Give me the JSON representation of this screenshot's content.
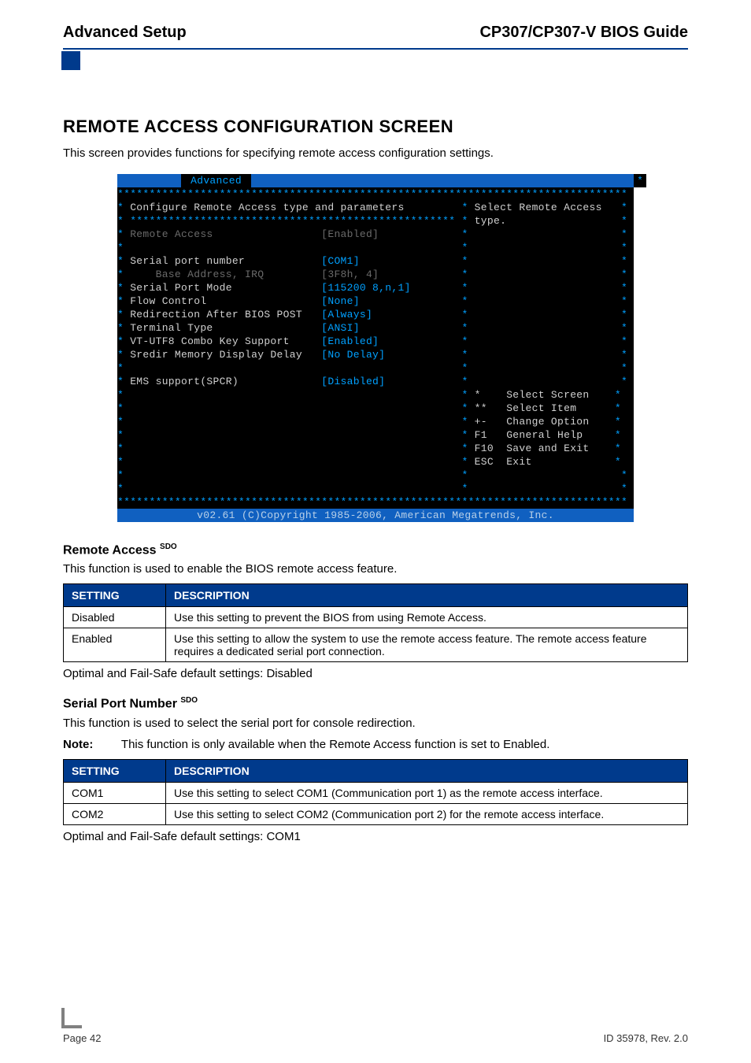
{
  "header": {
    "left": "Advanced Setup",
    "right": "CP307/CP307-V BIOS Guide"
  },
  "section": {
    "title": "REMOTE ACCESS CONFIGURATION SCREEN",
    "intro": "This screen provides functions for specifying remote access configuration settings."
  },
  "bios": {
    "tab": "Advanced",
    "header_line": "Configure Remote Access type and parameters",
    "help1": "Select Remote Access",
    "help2": "type.",
    "items": [
      {
        "label": "Remote Access",
        "value": "[Enabled]",
        "style": "grey"
      },
      {
        "label": "",
        "value": "",
        "style": "cyan"
      },
      {
        "label": "Serial port number",
        "value": "[COM1]",
        "style": "white"
      },
      {
        "label": "    Base Address, IRQ",
        "value": "[3F8h, 4]",
        "style": "grey"
      },
      {
        "label": "Serial Port Mode",
        "value": "[115200 8,n,1]",
        "style": "white"
      },
      {
        "label": "Flow Control",
        "value": "[None]",
        "style": "white"
      },
      {
        "label": "Redirection After BIOS POST",
        "value": "[Always]",
        "style": "white"
      },
      {
        "label": "Terminal Type",
        "value": "[ANSI]",
        "style": "white"
      },
      {
        "label": "VT-UTF8 Combo Key Support",
        "value": "[Enabled]",
        "style": "white"
      },
      {
        "label": "Sredir Memory Display Delay",
        "value": "[No Delay]",
        "style": "white"
      },
      {
        "label": "",
        "value": "",
        "style": "cyan"
      },
      {
        "label": "EMS support(SPCR)",
        "value": "[Disabled]",
        "style": "white"
      }
    ],
    "nav": [
      {
        "key": "*",
        "action": "Select Screen"
      },
      {
        "key": "**",
        "action": "Select Item"
      },
      {
        "key": "+-",
        "action": "Change Option"
      },
      {
        "key": "F1",
        "action": "General Help"
      },
      {
        "key": "F10",
        "action": "Save and Exit"
      },
      {
        "key": "ESC",
        "action": "Exit"
      }
    ],
    "copyright": "v02.61 (C)Copyright 1985-2006, American Megatrends, Inc."
  },
  "remote_access": {
    "heading": "Remote Access",
    "sup": "SDO",
    "desc": "This function is used to enable the BIOS remote access feature.",
    "table": {
      "h1": "Setting",
      "h2": "Description",
      "rows": [
        {
          "setting": "Disabled",
          "description": "Use this setting to prevent the BIOS from using Remote Access."
        },
        {
          "setting": "Enabled",
          "description": "Use this setting to allow the system to use the remote access feature. The remote access feature requires a dedicated serial port connection."
        }
      ]
    },
    "defaults": "Optimal and Fail-Safe default settings: Disabled"
  },
  "serial_port": {
    "heading": "Serial Port Number",
    "sup": "SDO",
    "desc": "This function is used to select the serial port for console redirection.",
    "note_label": "Note:",
    "note_text": "This function is only available when the Remote Access function is set to Enabled.",
    "table": {
      "h1": "Setting",
      "h2": "Description",
      "rows": [
        {
          "setting": "COM1",
          "description": "Use this setting to select COM1 (Communication port 1) as the remote access interface."
        },
        {
          "setting": "COM2",
          "description": "Use this setting to select COM2 (Communication port 2) for the remote access interface."
        }
      ]
    },
    "defaults": "Optimal and Fail-Safe default settings: COM1"
  },
  "footer": {
    "page": "Page 42",
    "id": "ID 35978, Rev. 2.0"
  }
}
